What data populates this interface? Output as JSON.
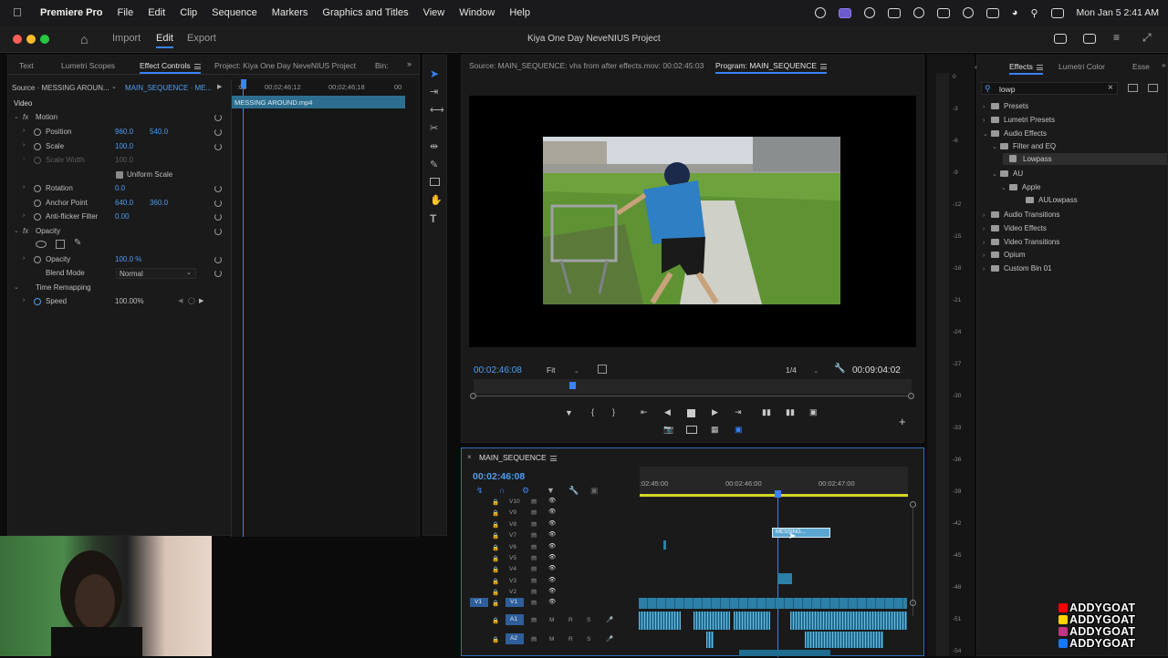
{
  "menubar": {
    "app": "Premiere Pro",
    "menus": [
      "File",
      "Edit",
      "Clip",
      "Sequence",
      "Markers",
      "Graphics and Titles",
      "View",
      "Window",
      "Help"
    ],
    "datetime": "Mon Jan 5  2:41 AM"
  },
  "titlebar": {
    "nav": [
      "Import",
      "Edit",
      "Export"
    ],
    "active_nav": "Edit",
    "project_title": "Kiya One Day NeveNIUS Project"
  },
  "left_panel": {
    "tabs": [
      "Text",
      "Lumetri Scopes",
      "Effect Controls",
      "Project: Kiya One Day NeveNIUS Project",
      "Bin:"
    ],
    "source_label": "Source · MESSING AROUN...",
    "sequence_label": "MAIN_SEQUENCE · ME...",
    "ruler_times": [
      ":00",
      "00;02;46;12",
      "00;02;46;18",
      "00"
    ],
    "clip_name": "MESSING AROUND.mp4",
    "section_video": "Video",
    "motion": "Motion",
    "position_label": "Position",
    "position_x": "960.0",
    "position_y": "540.0",
    "scale_label": "Scale",
    "scale_value": "100.0",
    "scale_width_label": "Scale Width",
    "scale_width_value": "100.0",
    "uniform_scale": "Uniform Scale",
    "rotation_label": "Rotation",
    "rotation_value": "0.0",
    "anchor_label": "Anchor Point",
    "anchor_x": "640.0",
    "anchor_y": "360.0",
    "antiflicker_label": "Anti-flicker Filter",
    "antiflicker_value": "0.00",
    "opacity_section": "Opacity",
    "opacity_label": "Opacity",
    "opacity_value": "100.0 %",
    "blend_label": "Blend Mode",
    "blend_value": "Normal",
    "time_remap": "Time Remapping",
    "speed_label": "Speed",
    "speed_value": "100.00%"
  },
  "program_monitor": {
    "source_tab": "Source: MAIN_SEQUENCE: vhs from after effects.mov: 00:02:45:03",
    "program_tab": "Program: MAIN_SEQUENCE",
    "timecode": "00:02:46:08",
    "fit": "Fit",
    "resolution": "1/4",
    "duration": "00:09:04:02"
  },
  "timeline": {
    "sequence_name": "MAIN_SEQUENCE",
    "timecode": "00:02:46:08",
    "ruler": [
      ":02:45:00",
      "00:02:46:00",
      "00:02:47:00"
    ],
    "video_tracks": [
      "V10",
      "V9",
      "V8",
      "V7",
      "V6",
      "V5",
      "V4",
      "V3",
      "V2",
      "V1"
    ],
    "audio_tracks": [
      "A1",
      "A2"
    ],
    "audio_buttons": [
      "M",
      "R",
      "S"
    ],
    "clip_label": "MESSING...",
    "source_patch": "V1"
  },
  "meter": {
    "labels": [
      "0",
      "-3",
      "-6",
      "-9",
      "-12",
      "-15",
      "-18",
      "-21",
      "-24",
      "-27",
      "-30",
      "-33",
      "-36",
      "-39",
      "-42",
      "-45",
      "-48",
      "-51",
      "-54"
    ]
  },
  "effects_panel": {
    "tabs": [
      "Effects",
      "Lumetri Color",
      "Esse"
    ],
    "search_value": "lowp",
    "tree": [
      {
        "label": "Presets",
        "level": 0,
        "expanded": false
      },
      {
        "label": "Lumetri Presets",
        "level": 0,
        "expanded": false
      },
      {
        "label": "Audio Effects",
        "level": 0,
        "expanded": true
      },
      {
        "label": "Filter and EQ",
        "level": 1,
        "expanded": true
      },
      {
        "label": "Lowpass",
        "level": 2,
        "item": true,
        "selected": true
      },
      {
        "label": "AU",
        "level": 1,
        "expanded": true
      },
      {
        "label": "Apple",
        "level": 2,
        "expanded": true
      },
      {
        "label": "AULowpass",
        "level": 3,
        "item": true
      },
      {
        "label": "Audio Transitions",
        "level": 0,
        "expanded": false
      },
      {
        "label": "Video Effects",
        "level": 0,
        "expanded": false
      },
      {
        "label": "Video Transitions",
        "level": 0,
        "expanded": false
      },
      {
        "label": "Opium",
        "level": 0,
        "expanded": false
      },
      {
        "label": "Custom Bin 01",
        "level": 0,
        "expanded": false
      }
    ]
  },
  "watermark": {
    "lines": [
      "ADDYGOAT",
      "ADDYGOAT",
      "ADDYGOAT",
      "ADDYGOAT"
    ],
    "colors": [
      "#ff0000",
      "#ffd400",
      "#c13584",
      "#1877f2"
    ]
  }
}
